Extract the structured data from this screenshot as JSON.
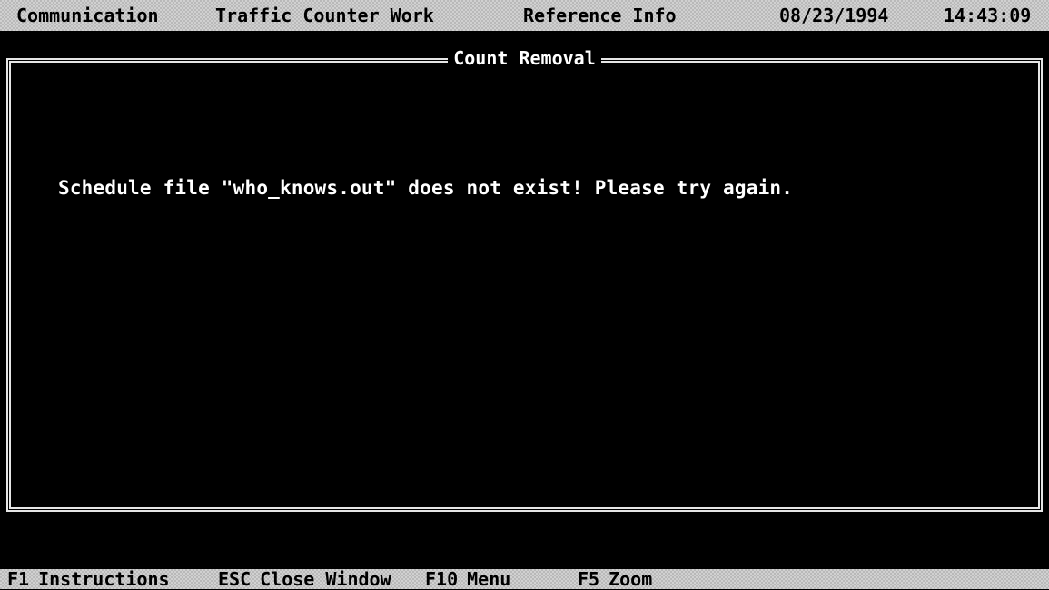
{
  "menubar": {
    "items": [
      {
        "label": "Communication"
      },
      {
        "label": "Traffic Counter Work"
      },
      {
        "label": "Reference Info"
      }
    ],
    "date": "08/23/1994",
    "time": "14:43:09"
  },
  "window": {
    "title": "Count Removal",
    "message": "Schedule file \"who_knows.out\" does not exist! Please try again."
  },
  "hints": [
    {
      "key": "F1",
      "label": "Instructions"
    },
    {
      "key": "ESC",
      "label": "Close Window"
    },
    {
      "key": "F10",
      "label": "Menu"
    },
    {
      "key": "F5",
      "label": "Zoom"
    }
  ],
  "colors": {
    "background": "#000000",
    "text": "#ffffff",
    "bar": "#b9b9b9"
  }
}
